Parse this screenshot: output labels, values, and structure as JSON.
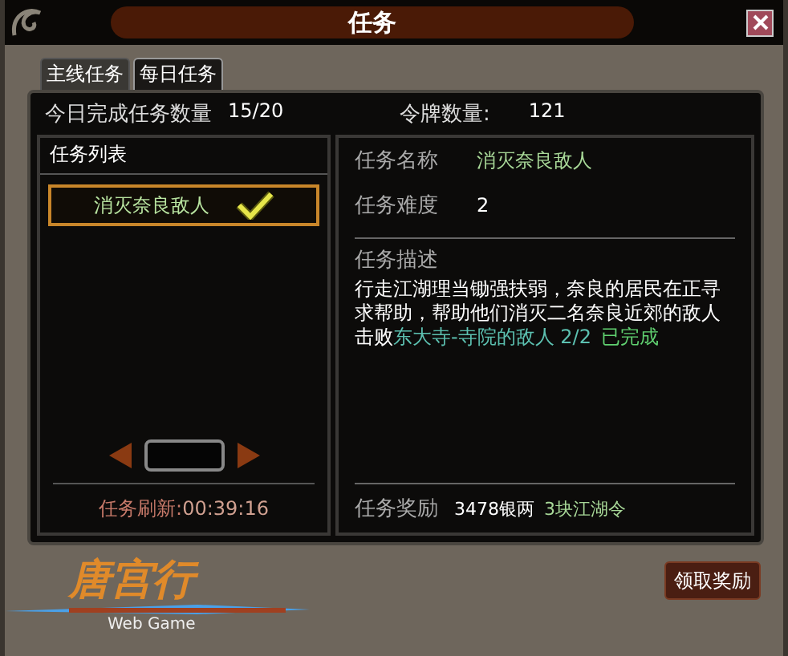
{
  "window": {
    "title": "任务"
  },
  "tabs": [
    {
      "label": "主线任务",
      "selected": false
    },
    {
      "label": "每日任务",
      "selected": true
    }
  ],
  "stats": {
    "completed_label": "今日完成任务数量",
    "completed_value": "15/20",
    "tokens_label": "令牌数量:",
    "tokens_value": "121"
  },
  "task_list": {
    "title": "任务列表",
    "items": [
      {
        "name": "消灭奈良敌人",
        "selected": true,
        "done": true
      }
    ],
    "refresh_label": "任务刷新:",
    "refresh_time": "00:39:16"
  },
  "details": {
    "name_label": "任务名称",
    "name_value": "消灭奈良敌人",
    "difficulty_label": "任务难度",
    "difficulty_value": "2",
    "description_label": "任务描述",
    "description": "行走江湖理当锄强扶弱，奈良的居民在正寻求帮助，帮助他们消灭二名奈良近郊的敌人",
    "objective": {
      "prefix": "击败",
      "target": "东大寺-寺院的敌人 2/2",
      "status": "已完成"
    },
    "reward_label": "任务奖励",
    "rewards": [
      {
        "text": "3478银两",
        "kind": "silver"
      },
      {
        "text": "3块江湖令",
        "kind": "token"
      }
    ]
  },
  "buttons": [
    "领取奖励"
  ],
  "logo": {
    "title": "唐宫行",
    "subtitle": "Web Game"
  }
}
